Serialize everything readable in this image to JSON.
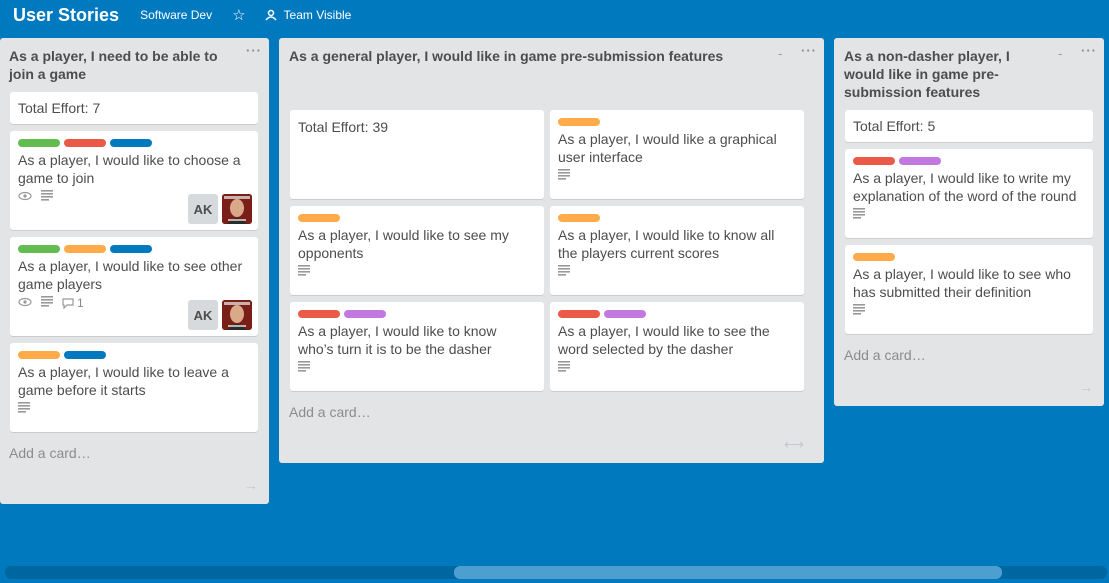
{
  "header": {
    "board_title": "User Stories",
    "team_button": "Software Dev",
    "visibility_label": "Team Visible"
  },
  "lists": [
    {
      "title_line1": "As a player, I need to be able to",
      "title_line2": "join a game",
      "effort": "Total Effort: 7",
      "cards": [
        {
          "line1": "As a player, I would like to choose a",
          "line2": "game to join",
          "labels": [
            "green",
            "red",
            "blue"
          ],
          "member_initials": "AK"
        },
        {
          "line1": "As a player, I would like to see other",
          "line2": "game players",
          "labels": [
            "green",
            "orange",
            "blue"
          ],
          "comments": "1",
          "member_initials": "AK"
        },
        {
          "line1": "As a player, I would like to leave a",
          "line2": "game before it starts",
          "labels": [
            "orange",
            "blue"
          ]
        }
      ],
      "add_card": "Add a card…"
    },
    {
      "title": "As a general player, I would like in game pre-submission features",
      "effort": "Total Effort: 39",
      "cards": [
        {
          "line1": "As a player, I would like a graphical",
          "line2": "user interface",
          "labels": [
            "orange"
          ]
        },
        {
          "line1": "As a player, I would like to see my",
          "line2": "opponents",
          "labels": [
            "orange"
          ]
        },
        {
          "line1": "As a player, I would like to know all",
          "line2": "the players current scores",
          "labels": [
            "orange"
          ]
        },
        {
          "line1": "As a player, I would like to know",
          "line2": "who’s turn it is to be the dasher",
          "labels": [
            "red",
            "purple"
          ]
        },
        {
          "line1": "As a player, I would like to see the",
          "line2": "word selected by the dasher",
          "labels": [
            "red",
            "purple"
          ]
        }
      ],
      "add_card": "Add a card…"
    },
    {
      "title_line1": "As a non-dasher player, I",
      "title_line2": "would like in game pre-",
      "title_line3": "submission features",
      "effort": "Total Effort: 5",
      "cards": [
        {
          "line1": "As a player, I would like to write my",
          "line2": "explanation of the word of the round",
          "labels": [
            "red",
            "purple"
          ]
        },
        {
          "line1": "As a player, I would like to see who",
          "line2": "has submitted their definition",
          "labels": [
            "orange"
          ]
        }
      ],
      "add_card": "Add a card…"
    }
  ],
  "colors": {
    "board_bg": "#0079bf",
    "green": "#61bd4f",
    "red": "#eb5a46",
    "blue": "#0079bf",
    "orange": "#ffab4a",
    "purple": "#c377e0"
  }
}
